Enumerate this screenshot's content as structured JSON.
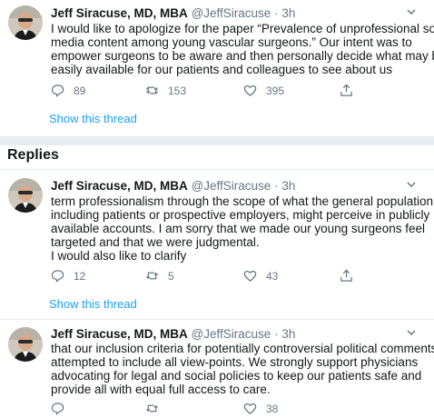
{
  "tweets": [
    {
      "author": "Jeff Siracuse, MD, MBA",
      "handle": "@JeffSiracuse",
      "separator": "·",
      "time": "3h",
      "lines": [
        "I would like to apologize for the paper “Prevalence of unprofessional social",
        "media content among young vascular surgeons.”  Our intent was to",
        "empower surgeons to be aware and then personally decide what may be",
        "easily available for our patients and colleagues to see about us"
      ],
      "replies": "89",
      "retweets": "153",
      "likes": "395",
      "show_thread": "Show this thread"
    },
    {
      "author": "Jeff Siracuse, MD, MBA",
      "handle": "@JeffSiracuse",
      "separator": "·",
      "time": "3h",
      "lines": [
        "term professionalism through the scope of what the general population,",
        "including patients or prospective employers, might perceive in publicly",
        "available accounts.  I am sorry that we made our young surgeons feel",
        "targeted and that we were judgmental.",
        "I would also like to clarify"
      ],
      "replies": "12",
      "retweets": "5",
      "likes": "43",
      "show_thread": "Show this thread"
    },
    {
      "author": "Jeff Siracuse, MD, MBA",
      "handle": "@JeffSiracuse",
      "separator": "·",
      "time": "3h",
      "lines": [
        "that our inclusion criteria for potentially controversial political comments",
        "attempted to include all view-points. We strongly support physicians",
        "advocating for legal and social policies to keep our patients safe and",
        "provide all with equal full access to care."
      ],
      "likes_partial": "38"
    }
  ],
  "replies_heading": "Replies",
  "icons": {
    "reply": "reply-icon",
    "retweet": "retweet-icon",
    "like": "heart-icon",
    "share": "share-icon",
    "more": "chevron-down-icon"
  },
  "colors": {
    "link": "#1da1f2",
    "muted": "#657786",
    "text": "#14171a",
    "divider": "#e6ecf0"
  }
}
